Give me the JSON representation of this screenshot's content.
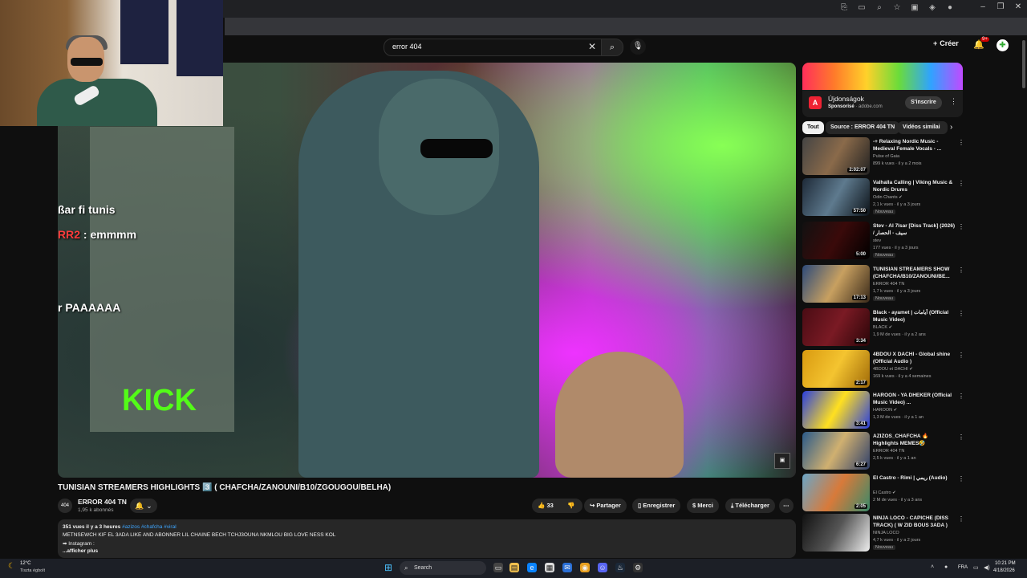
{
  "search": {
    "value": "error 404"
  },
  "header": {
    "create_label": "Créer",
    "notif_count": "9+"
  },
  "video": {
    "chat_lines": [
      "ßar fi tunis",
      "RR2",
      ": emmmm",
      "r PAAAAAA"
    ],
    "overlay_text": "KICK",
    "title": "TUNISIAN STREAMERS HIGHLIGHTS 3️⃣ ( CHAFCHA/ZANOUNI/B10/ZGOUGOU/BELHA)",
    "channel": {
      "name": "ERROR 404 TN",
      "subs": "1,95 k abonnés",
      "avatar_text": "404"
    },
    "actions": {
      "likes": "33",
      "share": "Partager",
      "save": "Enregistrer",
      "thanks": "Merci",
      "download": "Télécharger"
    },
    "description": {
      "views_date": "351 vues  il y a 3 heures",
      "tags": "#azizos #chafcha #viral",
      "line1": "METNSEWCH KIF EL 3ADA LIKE AND ABONNER LIL CHAINE BECH TCHJ3OUNA NKMLOU BIG LOVE NESS KOL",
      "line2": "➡ Instagram :",
      "more": "...afficher plus"
    }
  },
  "ad": {
    "title": "Újdonságok",
    "sponsored": "Sponsorisé",
    "domain": " · adobe.com",
    "subscribe": "S'inscrire"
  },
  "chips": [
    "Tout",
    "Source : ERROR 404 TN",
    "Vidéos similai"
  ],
  "recommendations": [
    {
      "title": "-+ Relaxing Nordic Music - Medieval Female Vocals - ...",
      "channel": "Pulse of Gaia",
      "meta": "899 k vues · il y a 2 mois",
      "duration": "2:02:07",
      "badge": "",
      "thumb": "linear-gradient(120deg,#444,#8a6a4a,#222)"
    },
    {
      "title": "Valhalla Calling | Viking Music & Nordic Drums",
      "channel": "Odin Chants ✔",
      "meta": "2,1 k vues · il y a 3 jours",
      "duration": "57:50",
      "badge": "Nouveau",
      "thumb": "linear-gradient(120deg,#1e2a38,#5e7a8e,#0c1218)"
    },
    {
      "title": "Stev - Al 7lsar [Diss Track] (2026) / سيف - الحصار",
      "channel": "stev",
      "meta": "177 vues · il y a 3 jours",
      "duration": "5:00",
      "badge": "Nouveau",
      "thumb": "linear-gradient(120deg,#111,#3a0a0a,#000)"
    },
    {
      "title": "TUNISIAN STREAMERS SHOW (CHAFCHA/B10/ZANOUNI/BE...",
      "channel": "ERROR 404 TN",
      "meta": "1,7 k vues · il y a 3 jours",
      "duration": "17:13",
      "badge": "Nouveau",
      "thumb": "linear-gradient(120deg,#2c4a7a,#c8a060,#3a2a1a)"
    },
    {
      "title": "Black - ayamet | أيامات (Official Music Video)",
      "channel": "BLACK ✔",
      "meta": "1,9 M de vues · il y a 2 ans",
      "duration": "3:34",
      "badge": "",
      "thumb": "linear-gradient(120deg,#4a0c14,#7a1a24,#2a0508)"
    },
    {
      "title": "4BDOU X DACHI - Global shine (Official Audio )",
      "channel": "4BDOU et DACHI ✔",
      "meta": "169 k vues · il y a 4 semaines",
      "duration": "2:17",
      "badge": "",
      "thumb": "linear-gradient(120deg,#d99a10,#f4c430,#a06a08)"
    },
    {
      "title": "HAROON - YA DHEKER (Official Music Video) ...",
      "channel": "HAROON ✔",
      "meta": "1,3 M de vues · il y a 1 an",
      "duration": "3:41",
      "badge": "",
      "thumb": "linear-gradient(120deg,#2a3fe0,#ffe020,#2a3fe0)"
    },
    {
      "title": "AZIZOS_CHAFCHA 🔥 Highlights MEMES🤣",
      "channel": "ERROR 404 TN",
      "meta": "2,5 k vues · il y a 1 an",
      "duration": "6:27",
      "badge": "",
      "thumb": "linear-gradient(120deg,#2a5a8a,#d0b070,#30406a)"
    },
    {
      "title": "El Castro - Rimi | ريمي (Audio)",
      "channel": "El Castro ✔",
      "meta": "2 M de vues · il y a 3 ans",
      "duration": "2:05",
      "badge": "",
      "thumb": "linear-gradient(120deg,#6aa6c8,#d87a3a,#3a8a6a)"
    },
    {
      "title": "NINJA LOCO - CAPICHE (DISS TRACK) ( W ZID BOUS 3ADA )",
      "channel": "NINJA LOCO",
      "meta": "4,7 k vues · il y a 2 jours",
      "duration": "",
      "badge": "Nouveau",
      "thumb": "linear-gradient(120deg,#111,#555,#eee)"
    }
  ],
  "taskbar": {
    "weather_temp": "12°C",
    "weather_desc": "Tiszta égbolt",
    "search_label": "Search",
    "lang": "FRA",
    "time": "10:21 PM",
    "date": "4/18/2026"
  }
}
